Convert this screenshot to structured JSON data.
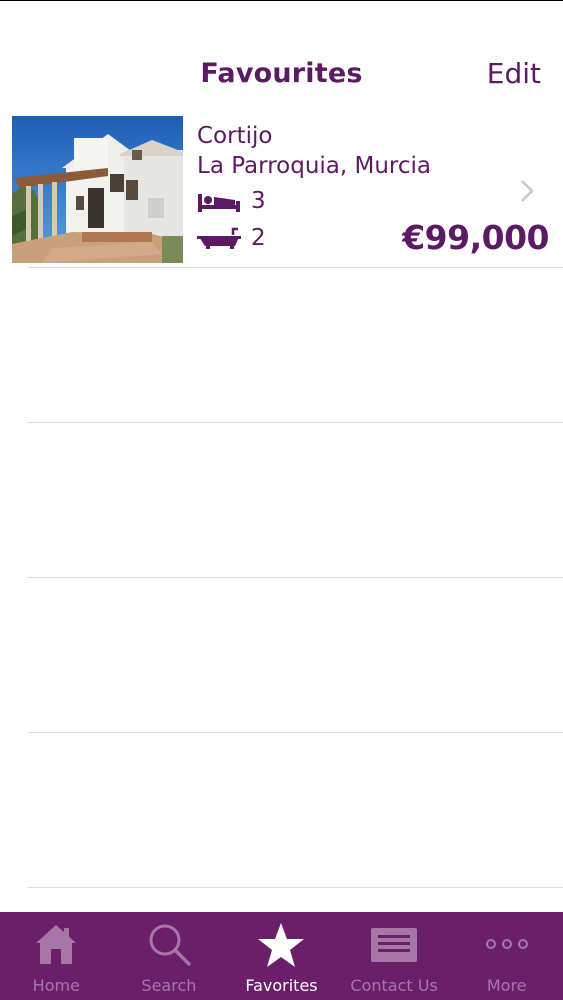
{
  "nav": {
    "title": "Favourites",
    "edit_label": "Edit"
  },
  "listing": {
    "type": "Cortijo",
    "location": "La Parroquia, Murcia",
    "bedrooms": "3",
    "bathrooms": "2",
    "price": "€99,000"
  },
  "tabs": [
    {
      "label": "Home",
      "icon": "home-icon",
      "active": false
    },
    {
      "label": "Search",
      "icon": "search-icon",
      "active": false
    },
    {
      "label": "Favorites",
      "icon": "star-icon",
      "active": true
    },
    {
      "label": "Contact Us",
      "icon": "contact-card-icon",
      "active": false
    },
    {
      "label": "More",
      "icon": "more-dots-icon",
      "active": false
    }
  ],
  "colors": {
    "brand_purple": "#5b1a63",
    "tab_bar_bg": "#6b1f6b",
    "tab_inactive": "#a677a6",
    "tab_active": "#ffffff",
    "separator": "#dcdcdc"
  }
}
